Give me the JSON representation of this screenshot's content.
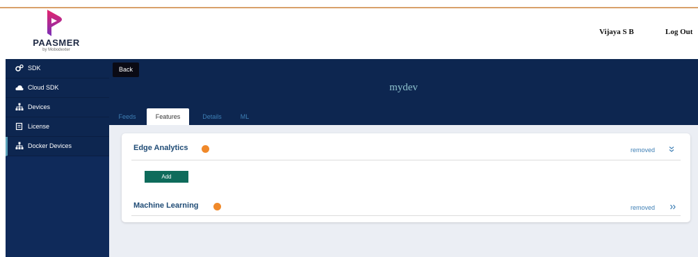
{
  "brand": {
    "name": "PAASMER",
    "tagline": "by Mobodexter",
    "colors": {
      "accent": "#e4246c",
      "navy": "#0d2650",
      "orange": "#f0892a",
      "green": "#0e6b5b"
    }
  },
  "header": {
    "user_name": "Vijaya S B",
    "logout_label": "Log Out"
  },
  "sidebar": {
    "items": [
      {
        "label": "SDK",
        "icon": "cogs-icon"
      },
      {
        "label": "Cloud SDK",
        "icon": "cloud-icon"
      },
      {
        "label": "Devices",
        "icon": "sitemap-icon"
      },
      {
        "label": "License",
        "icon": "license-icon"
      },
      {
        "label": "Docker Devices",
        "icon": "sitemap-icon",
        "active": true
      }
    ]
  },
  "main": {
    "back_label": "Back",
    "device_name": "mydev",
    "tabs": [
      {
        "label": "Feeds"
      },
      {
        "label": "Features",
        "active": true
      },
      {
        "label": "Details"
      },
      {
        "label": "ML"
      }
    ],
    "sections": [
      {
        "title": "Edge Analytics",
        "status": "removed",
        "expanded": true,
        "add_label": "Add"
      },
      {
        "title": "Machine Learning",
        "status": "removed",
        "expanded": false
      }
    ]
  }
}
